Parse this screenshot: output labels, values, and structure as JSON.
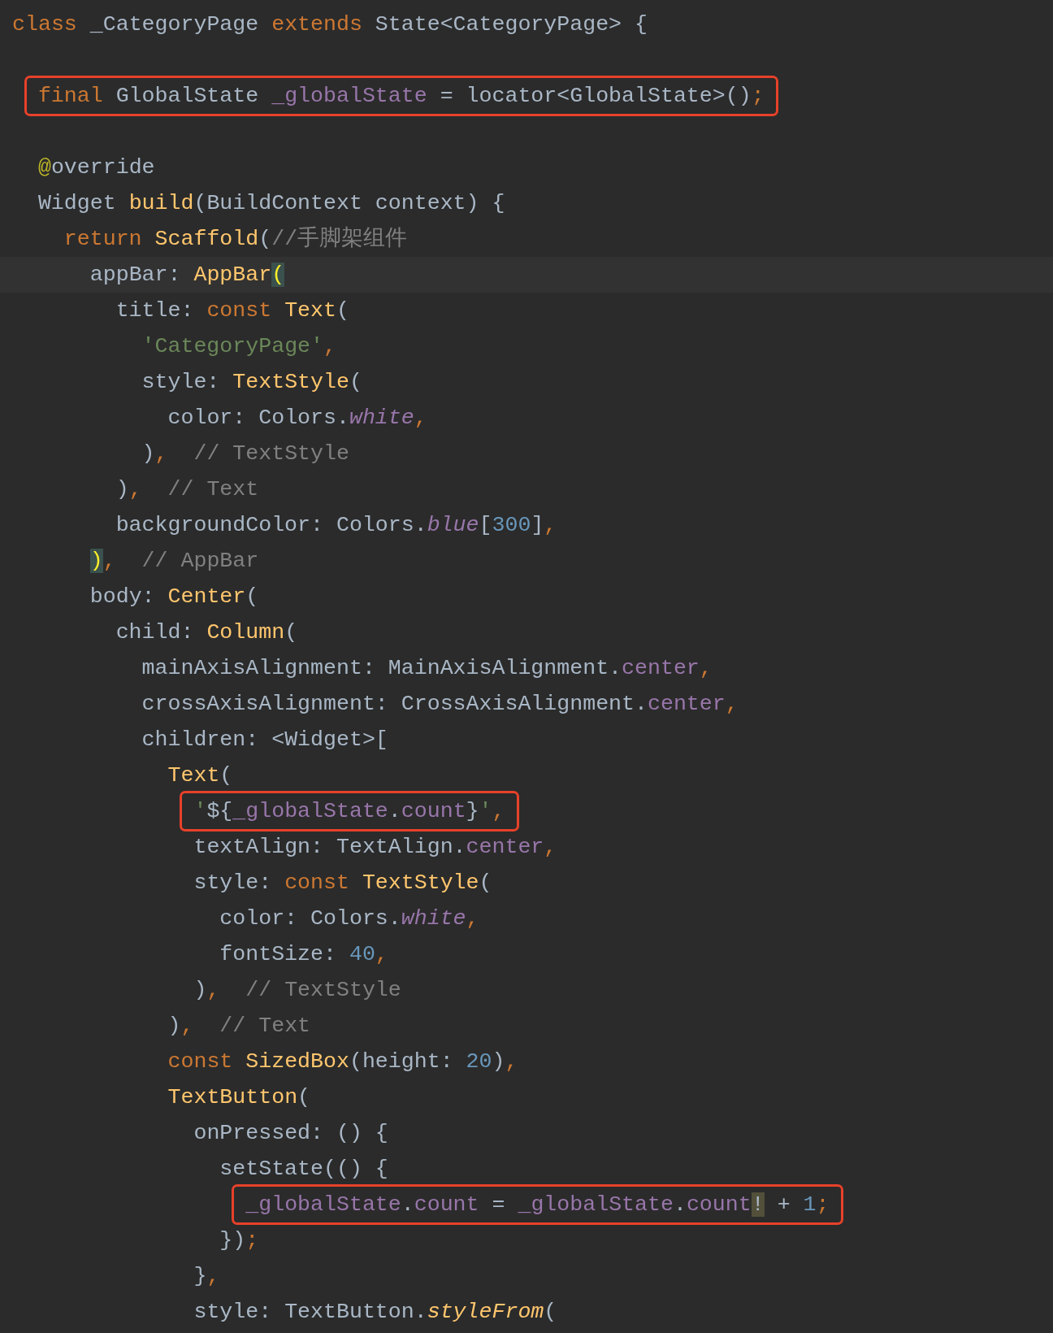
{
  "editor": {
    "lines": [
      {
        "kind": "code",
        "tokens": [
          {
            "kind": "keyword",
            "text": "class"
          },
          {
            "kind": "plain",
            "text": " _CategoryPage "
          },
          {
            "kind": "keyword",
            "text": "extends"
          },
          {
            "kind": "plain",
            "text": " State<CategoryPage> {"
          }
        ],
        "children": [
          {
            "kind": "blank"
          },
          {
            "kind": "code",
            "boxed": true,
            "tokens": [
              {
                "kind": "keyword",
                "text": "final"
              },
              {
                "kind": "plain",
                "text": " GlobalState "
              },
              {
                "kind": "field",
                "text": "_globalState"
              },
              {
                "kind": "plain",
                "text": " = locator<GlobalState>()"
              },
              {
                "kind": "keyword",
                "text": ";"
              }
            ]
          },
          {
            "kind": "blank"
          },
          {
            "kind": "code",
            "tokens": [
              {
                "kind": "annotation",
                "text": "@"
              },
              {
                "kind": "plain",
                "text": "override"
              }
            ]
          },
          {
            "kind": "code",
            "tokens": [
              {
                "kind": "plain",
                "text": "Widget "
              },
              {
                "kind": "function",
                "text": "build"
              },
              {
                "kind": "plain",
                "text": "(BuildContext context) {"
              }
            ],
            "children": [
              {
                "kind": "code",
                "tokens": [
                  {
                    "kind": "keyword",
                    "text": "return "
                  },
                  {
                    "kind": "function",
                    "text": "Scaffold"
                  },
                  {
                    "kind": "plain",
                    "text": "("
                  },
                  {
                    "kind": "comment",
                    "text": "//手脚架组件"
                  }
                ],
                "children": [
                  {
                    "kind": "code",
                    "current": true,
                    "tokens": [
                      {
                        "kind": "plain",
                        "text": "appBar: "
                      },
                      {
                        "kind": "function",
                        "text": "AppBar"
                      },
                      {
                        "kind": "match",
                        "text": "("
                      }
                    ],
                    "children": [
                      {
                        "kind": "code",
                        "tokens": [
                          {
                            "kind": "plain",
                            "text": "title: "
                          },
                          {
                            "kind": "keyword",
                            "text": "const "
                          },
                          {
                            "kind": "function",
                            "text": "Text"
                          },
                          {
                            "kind": "plain",
                            "text": "("
                          }
                        ],
                        "children": [
                          {
                            "kind": "code",
                            "tokens": [
                              {
                                "kind": "string",
                                "text": "'CategoryPage'"
                              },
                              {
                                "kind": "keyword",
                                "text": ","
                              }
                            ]
                          },
                          {
                            "kind": "code",
                            "tokens": [
                              {
                                "kind": "plain",
                                "text": "style: "
                              },
                              {
                                "kind": "function",
                                "text": "TextStyle"
                              },
                              {
                                "kind": "plain",
                                "text": "("
                              }
                            ],
                            "children": [
                              {
                                "kind": "code",
                                "tokens": [
                                  {
                                    "kind": "plain",
                                    "text": "color: Colors."
                                  },
                                  {
                                    "kind": "static",
                                    "text": "white"
                                  },
                                  {
                                    "kind": "keyword",
                                    "text": ","
                                  }
                                ]
                              }
                            ]
                          },
                          {
                            "kind": "code",
                            "tokens": [
                              {
                                "kind": "plain",
                                "text": ")"
                              },
                              {
                                "kind": "keyword",
                                "text": ","
                              },
                              {
                                "kind": "comment",
                                "text": "  // TextStyle"
                              }
                            ]
                          }
                        ]
                      },
                      {
                        "kind": "code",
                        "tokens": [
                          {
                            "kind": "plain",
                            "text": ")"
                          },
                          {
                            "kind": "keyword",
                            "text": ","
                          },
                          {
                            "kind": "comment",
                            "text": "  // Text"
                          }
                        ]
                      },
                      {
                        "kind": "code",
                        "tokens": [
                          {
                            "kind": "plain",
                            "text": "backgroundColor: Colors."
                          },
                          {
                            "kind": "static",
                            "text": "blue"
                          },
                          {
                            "kind": "plain",
                            "text": "["
                          },
                          {
                            "kind": "number",
                            "text": "300"
                          },
                          {
                            "kind": "plain",
                            "text": "]"
                          },
                          {
                            "kind": "keyword",
                            "text": ","
                          }
                        ]
                      }
                    ]
                  },
                  {
                    "kind": "code",
                    "tokens": [
                      {
                        "kind": "match",
                        "text": ")"
                      },
                      {
                        "kind": "keyword",
                        "text": ","
                      },
                      {
                        "kind": "comment",
                        "text": "  // AppBar"
                      }
                    ]
                  },
                  {
                    "kind": "code",
                    "tokens": [
                      {
                        "kind": "plain",
                        "text": "body: "
                      },
                      {
                        "kind": "function",
                        "text": "Center"
                      },
                      {
                        "kind": "plain",
                        "text": "("
                      }
                    ],
                    "children": [
                      {
                        "kind": "code",
                        "tokens": [
                          {
                            "kind": "plain",
                            "text": "child: "
                          },
                          {
                            "kind": "function",
                            "text": "Column"
                          },
                          {
                            "kind": "plain",
                            "text": "("
                          }
                        ],
                        "children": [
                          {
                            "kind": "code",
                            "tokens": [
                              {
                                "kind": "plain",
                                "text": "mainAxisAlignment: MainAxisAlignment."
                              },
                              {
                                "kind": "field",
                                "text": "center"
                              },
                              {
                                "kind": "keyword",
                                "text": ","
                              }
                            ]
                          },
                          {
                            "kind": "code",
                            "tokens": [
                              {
                                "kind": "plain",
                                "text": "crossAxisAlignment: CrossAxisAlignment."
                              },
                              {
                                "kind": "field",
                                "text": "center"
                              },
                              {
                                "kind": "keyword",
                                "text": ","
                              }
                            ]
                          },
                          {
                            "kind": "code",
                            "tokens": [
                              {
                                "kind": "plain",
                                "text": "children: <Widget>["
                              }
                            ],
                            "children": [
                              {
                                "kind": "code",
                                "tokens": [
                                  {
                                    "kind": "function",
                                    "text": "Text"
                                  },
                                  {
                                    "kind": "plain",
                                    "text": "("
                                  }
                                ],
                                "children": [
                                  {
                                    "kind": "code",
                                    "boxed": true,
                                    "tokens": [
                                      {
                                        "kind": "string",
                                        "text": "'"
                                      },
                                      {
                                        "kind": "plain",
                                        "text": "${"
                                      },
                                      {
                                        "kind": "field",
                                        "text": "_globalState"
                                      },
                                      {
                                        "kind": "plain",
                                        "text": "."
                                      },
                                      {
                                        "kind": "field",
                                        "text": "count"
                                      },
                                      {
                                        "kind": "plain",
                                        "text": "}"
                                      },
                                      {
                                        "kind": "string",
                                        "text": "'"
                                      },
                                      {
                                        "kind": "keyword",
                                        "text": ","
                                      }
                                    ]
                                  },
                                  {
                                    "kind": "code",
                                    "tokens": [
                                      {
                                        "kind": "plain",
                                        "text": "textAlign: TextAlign."
                                      },
                                      {
                                        "kind": "field",
                                        "text": "center"
                                      },
                                      {
                                        "kind": "keyword",
                                        "text": ","
                                      }
                                    ]
                                  },
                                  {
                                    "kind": "code",
                                    "tokens": [
                                      {
                                        "kind": "plain",
                                        "text": "style: "
                                      },
                                      {
                                        "kind": "keyword",
                                        "text": "const "
                                      },
                                      {
                                        "kind": "function",
                                        "text": "TextStyle"
                                      },
                                      {
                                        "kind": "plain",
                                        "text": "("
                                      }
                                    ],
                                    "children": [
                                      {
                                        "kind": "code",
                                        "tokens": [
                                          {
                                            "kind": "plain",
                                            "text": "color: Colors."
                                          },
                                          {
                                            "kind": "static",
                                            "text": "white"
                                          },
                                          {
                                            "kind": "keyword",
                                            "text": ","
                                          }
                                        ]
                                      },
                                      {
                                        "kind": "code",
                                        "tokens": [
                                          {
                                            "kind": "plain",
                                            "text": "fontSize: "
                                          },
                                          {
                                            "kind": "number",
                                            "text": "40"
                                          },
                                          {
                                            "kind": "keyword",
                                            "text": ","
                                          }
                                        ]
                                      }
                                    ]
                                  },
                                  {
                                    "kind": "code",
                                    "tokens": [
                                      {
                                        "kind": "plain",
                                        "text": ")"
                                      },
                                      {
                                        "kind": "keyword",
                                        "text": ","
                                      },
                                      {
                                        "kind": "comment",
                                        "text": "  // TextStyle"
                                      }
                                    ]
                                  }
                                ]
                              },
                              {
                                "kind": "code",
                                "tokens": [
                                  {
                                    "kind": "plain",
                                    "text": ")"
                                  },
                                  {
                                    "kind": "keyword",
                                    "text": ","
                                  },
                                  {
                                    "kind": "comment",
                                    "text": "  // Text"
                                  }
                                ]
                              },
                              {
                                "kind": "code",
                                "tokens": [
                                  {
                                    "kind": "keyword",
                                    "text": "const "
                                  },
                                  {
                                    "kind": "function",
                                    "text": "SizedBox"
                                  },
                                  {
                                    "kind": "plain",
                                    "text": "(height: "
                                  },
                                  {
                                    "kind": "number",
                                    "text": "20"
                                  },
                                  {
                                    "kind": "plain",
                                    "text": ")"
                                  },
                                  {
                                    "kind": "keyword",
                                    "text": ","
                                  }
                                ]
                              },
                              {
                                "kind": "code",
                                "tokens": [
                                  {
                                    "kind": "function",
                                    "text": "TextButton"
                                  },
                                  {
                                    "kind": "plain",
                                    "text": "("
                                  }
                                ],
                                "children": [
                                  {
                                    "kind": "code",
                                    "tokens": [
                                      {
                                        "kind": "plain",
                                        "text": "onPressed: () {"
                                      }
                                    ],
                                    "children": [
                                      {
                                        "kind": "code",
                                        "tokens": [
                                          {
                                            "kind": "plain",
                                            "text": "setState(() {"
                                          }
                                        ],
                                        "children": [
                                          {
                                            "kind": "code",
                                            "boxed": true,
                                            "tokens": [
                                              {
                                                "kind": "field",
                                                "text": "_globalState"
                                              },
                                              {
                                                "kind": "plain",
                                                "text": "."
                                              },
                                              {
                                                "kind": "field",
                                                "text": "count"
                                              },
                                              {
                                                "kind": "plain",
                                                "text": " = "
                                              },
                                              {
                                                "kind": "field",
                                                "text": "_globalState"
                                              },
                                              {
                                                "kind": "plain",
                                                "text": "."
                                              },
                                              {
                                                "kind": "field",
                                                "text": "count"
                                              },
                                              {
                                                "kind": "mark",
                                                "text": "!"
                                              },
                                              {
                                                "kind": "plain",
                                                "text": " + "
                                              },
                                              {
                                                "kind": "number",
                                                "text": "1"
                                              },
                                              {
                                                "kind": "keyword",
                                                "text": ";"
                                              }
                                            ]
                                          }
                                        ]
                                      },
                                      {
                                        "kind": "code",
                                        "tokens": [
                                          {
                                            "kind": "plain",
                                            "text": "})"
                                          },
                                          {
                                            "kind": "keyword",
                                            "text": ";"
                                          }
                                        ]
                                      }
                                    ]
                                  },
                                  {
                                    "kind": "code",
                                    "tokens": [
                                      {
                                        "kind": "plain",
                                        "text": "}"
                                      },
                                      {
                                        "kind": "keyword",
                                        "text": ","
                                      }
                                    ]
                                  },
                                  {
                                    "kind": "code",
                                    "tokens": [
                                      {
                                        "kind": "plain",
                                        "text": "style: TextButton."
                                      },
                                      {
                                        "kind": "method",
                                        "text": "styleFrom"
                                      },
                                      {
                                        "kind": "plain",
                                        "text": "("
                                      }
                                    ]
                                  }
                                ]
                              }
                            ]
                          }
                        ]
                      }
                    ]
                  }
                ]
              }
            ]
          }
        ]
      }
    ]
  }
}
